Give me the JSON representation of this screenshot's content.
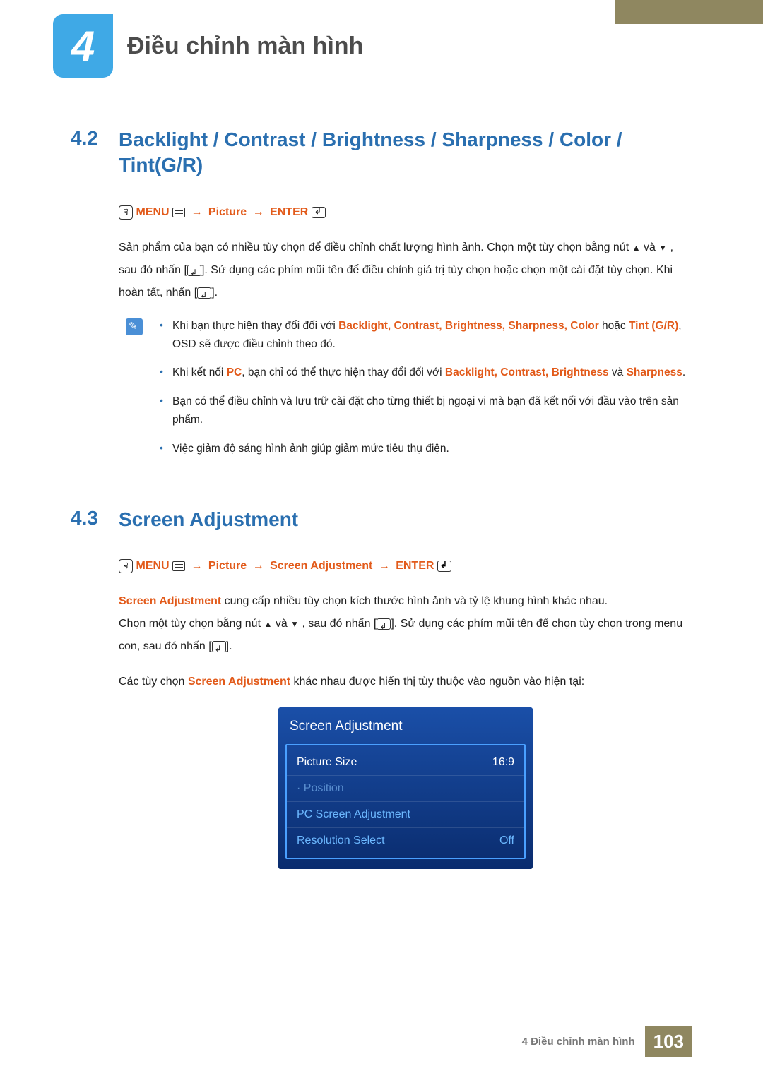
{
  "chapter": {
    "number": "4",
    "title": "Điều chỉnh màn hình"
  },
  "section42": {
    "num": "4.2",
    "title": "Backlight / Contrast / Brightness / Sharpness / Color / Tint(G/R)",
    "menu_path": {
      "menu": "MENU",
      "picture": "Picture",
      "enter": "ENTER"
    },
    "body_before": "Sản phẩm của bạn có nhiều tùy chọn để điều chỉnh chất lượng hình ảnh. Chọn một tùy chọn bằng nút ",
    "body_mid1": " và ",
    "body_mid2": ", sau đó nhấn [",
    "body_mid3": "]. Sử dụng các phím mũi tên để điều chỉnh giá trị tùy chọn hoặc chọn một cài đặt tùy chọn. Khi hoàn tất, nhấn [",
    "body_end": "].",
    "notes": {
      "n1_a": "Khi bạn thực hiện thay đổi đối với ",
      "n1_terms": "Backlight, Contrast, Brightness, Sharpness, Color",
      "n1_b": " hoặc ",
      "n1_tint": "Tint (G/R)",
      "n1_c": ", OSD sẽ được điều chỉnh theo đó.",
      "n2_a": "Khi kết nối ",
      "n2_pc": "PC",
      "n2_b": ", bạn chỉ có thể thực hiện thay đổi đối với ",
      "n2_terms": "Backlight, Contrast, Brightness",
      "n2_c": " và ",
      "n2_sharp": "Sharpness",
      "n2_d": ".",
      "n3": "Bạn có thể điều chỉnh và lưu trữ cài đặt cho từng thiết bị ngoại vi mà bạn đã kết nối với đầu vào trên sản phẩm.",
      "n4": "Việc giảm độ sáng hình ảnh giúp giảm mức tiêu thụ điện."
    }
  },
  "section43": {
    "num": "4.3",
    "title": "Screen Adjustment",
    "menu_path": {
      "menu": "MENU",
      "picture": "Picture",
      "screen_adj": "Screen Adjustment",
      "enter": "ENTER"
    },
    "p1_a": "Screen Adjustment",
    "p1_b": " cung cấp nhiều tùy chọn kích thước hình ảnh và tỷ lệ khung hình khác nhau.",
    "p2_a": "Chọn một tùy chọn bằng nút ",
    "p2_b": " và ",
    "p2_c": ", sau đó nhấn [",
    "p2_d": "]. Sử dụng các phím mũi tên để chọn tùy chọn trong menu con, sau đó nhấn [",
    "p2_e": "].",
    "p3_a": "Các tùy chọn ",
    "p3_b": "Screen Adjustment",
    "p3_c": " khác nhau được hiển thị tùy thuộc vào nguồn vào hiện tại:"
  },
  "osd": {
    "title": "Screen Adjustment",
    "rows": [
      {
        "label": "Picture Size",
        "value": "16:9"
      },
      {
        "label": "· Position",
        "value": ""
      },
      {
        "label": "PC Screen Adjustment",
        "value": ""
      },
      {
        "label": "Resolution Select",
        "value": "Off"
      }
    ]
  },
  "footer": {
    "chapter_label": "4 Điều chỉnh màn hình",
    "page": "103"
  }
}
